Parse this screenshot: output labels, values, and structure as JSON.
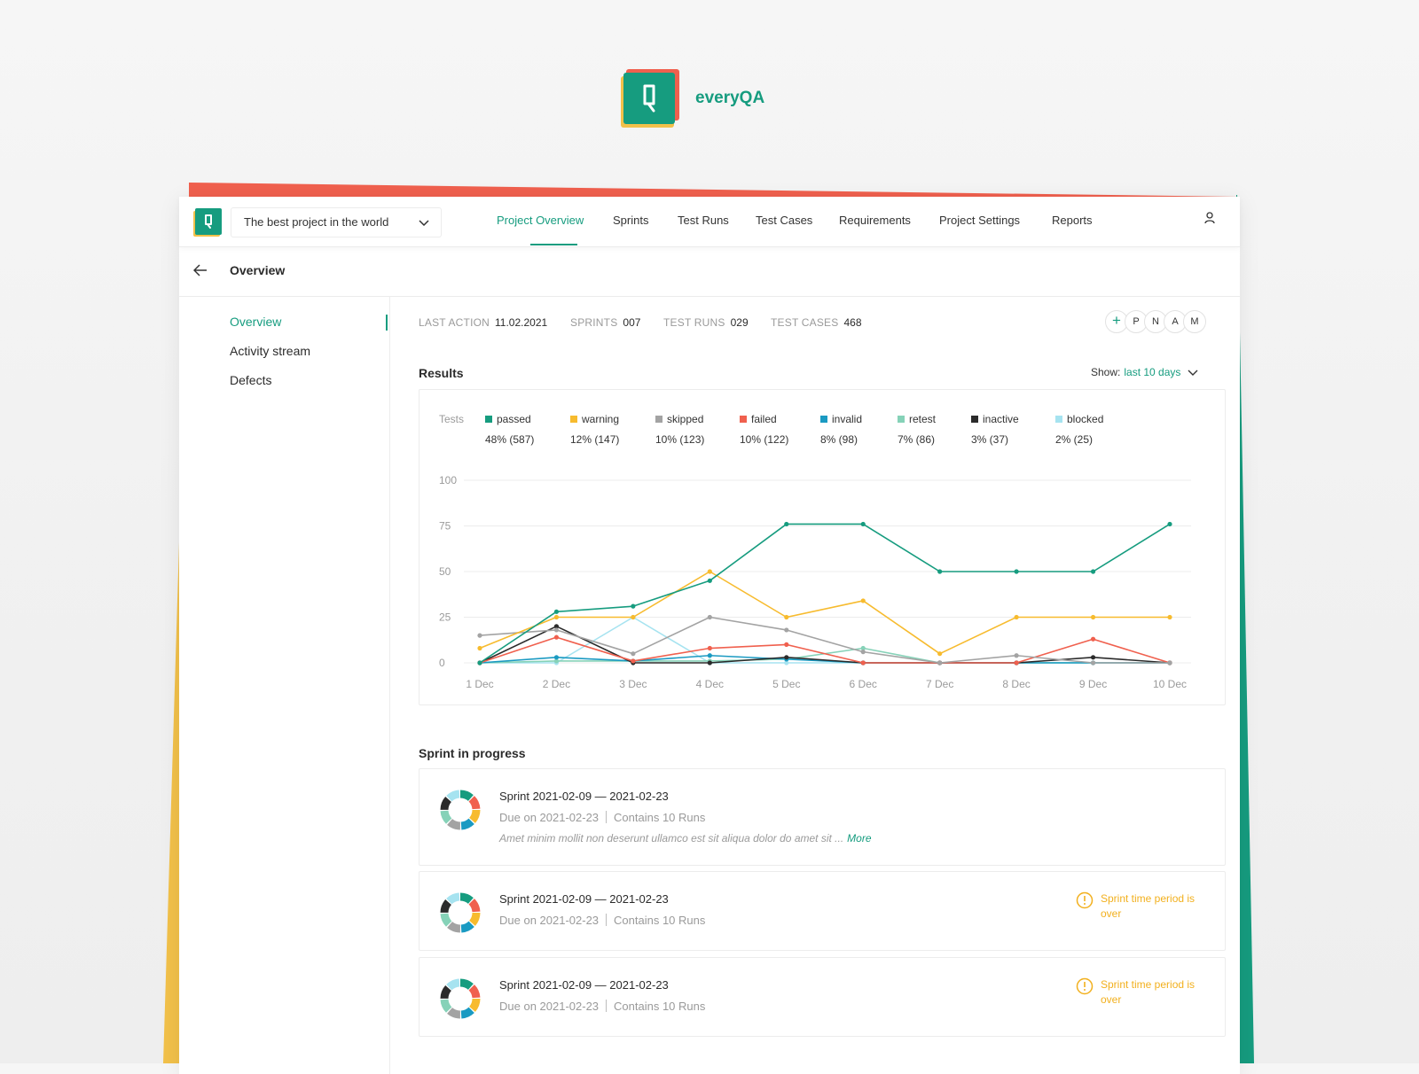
{
  "brand": {
    "name": "everyQA",
    "logo_icon": "qa-logo-icon"
  },
  "colors": {
    "accent": "#169c7f",
    "red": "#f0604e",
    "yellow": "#f2c14a",
    "passed": "#169c7f",
    "warning": "#f7bb2e",
    "skipped": "#a3a3a3",
    "failed": "#f0604e",
    "invalid": "#1a9ac2",
    "retest": "#86d2b8",
    "inactive": "#2b2b2b",
    "blocked": "#a6e3f0"
  },
  "topbar": {
    "project": "The best project in the world",
    "nav": [
      {
        "label": "Project Overview",
        "active": true
      },
      {
        "label": "Sprints"
      },
      {
        "label": "Test Runs"
      },
      {
        "label": "Test Cases"
      },
      {
        "label": "Requirements"
      },
      {
        "label": "Project Settings"
      },
      {
        "label": "Reports"
      }
    ],
    "user_icon": "user-icon"
  },
  "page": {
    "title": "Overview",
    "back_icon": "arrow-left-icon"
  },
  "sidebar": {
    "items": [
      {
        "label": "Overview",
        "active": true
      },
      {
        "label": "Activity stream"
      },
      {
        "label": "Defects"
      }
    ]
  },
  "stats": [
    {
      "key": "LAST ACTION",
      "value": "11.02.2021"
    },
    {
      "key": "SPRINTS",
      "value": "007"
    },
    {
      "key": "TEST RUNS",
      "value": "029"
    },
    {
      "key": "TEST CASES",
      "value": "468"
    }
  ],
  "members": {
    "add": "+",
    "initials": [
      "P",
      "N",
      "A",
      "M"
    ]
  },
  "results": {
    "title": "Results",
    "show_label": "Show:",
    "show_value": "last 10 days"
  },
  "legend": {
    "prefix": "Tests",
    "items": [
      {
        "name": "passed",
        "value": "48% (587)"
      },
      {
        "name": "warning",
        "value": "12% (147)"
      },
      {
        "name": "skipped",
        "value": "10% (123)"
      },
      {
        "name": "failed",
        "value": "10% (122)"
      },
      {
        "name": "invalid",
        "value": "8% (98)"
      },
      {
        "name": "retest",
        "value": "7% (86)"
      },
      {
        "name": "inactive",
        "value": "3% (37)"
      },
      {
        "name": "blocked",
        "value": "2% (25)"
      }
    ]
  },
  "chart_data": {
    "type": "line",
    "x": [
      "1 Dec",
      "2 Dec",
      "3 Dec",
      "4 Dec",
      "5 Dec",
      "6 Dec",
      "7 Dec",
      "8 Dec",
      "9 Dec",
      "10 Dec"
    ],
    "ylim": [
      0,
      100
    ],
    "yticks": [
      0,
      25,
      50,
      75,
      100
    ],
    "grid": true,
    "series": [
      {
        "name": "passed",
        "values": [
          0,
          28,
          31,
          45,
          76,
          76,
          50,
          50,
          50,
          76
        ]
      },
      {
        "name": "warning",
        "values": [
          8,
          25,
          25,
          50,
          25,
          34,
          5,
          25,
          25,
          25
        ]
      },
      {
        "name": "skipped",
        "values": [
          15,
          18,
          5,
          25,
          18,
          6,
          0,
          4,
          0,
          0
        ]
      },
      {
        "name": "failed",
        "values": [
          0,
          14,
          1,
          8,
          10,
          0,
          0,
          0,
          13,
          0
        ]
      },
      {
        "name": "invalid",
        "values": [
          0,
          3,
          1,
          4,
          2,
          0,
          0,
          0,
          0,
          0
        ]
      },
      {
        "name": "retest",
        "values": [
          0,
          1,
          1,
          1,
          2,
          8,
          0,
          0,
          0,
          0
        ]
      },
      {
        "name": "inactive",
        "values": [
          0,
          20,
          0,
          0,
          3,
          0,
          0,
          0,
          3,
          0
        ]
      },
      {
        "name": "blocked",
        "values": [
          0,
          0,
          25,
          0,
          0,
          0,
          0,
          0,
          0,
          0
        ]
      }
    ]
  },
  "sprints": {
    "title": "Sprint in progress",
    "items": [
      {
        "name": "Sprint 2021-02-09 — 2021-02-23",
        "due": "Due on 2021-02-23",
        "runs": "Contains 10 Runs",
        "desc": "Amet minim mollit non deserunt ullamco est sit aliqua dolor do amet sit ...",
        "more": "More",
        "warning": ""
      },
      {
        "name": "Sprint 2021-02-09 — 2021-02-23",
        "due": "Due on 2021-02-23",
        "runs": "Contains 10 Runs",
        "desc": "",
        "more": "",
        "warning": "Sprint time period is over"
      },
      {
        "name": "Sprint 2021-02-09 — 2021-02-23",
        "due": "Due on 2021-02-23",
        "runs": "Contains 10 Runs",
        "desc": "",
        "more": "",
        "warning": "Sprint time period is over"
      }
    ]
  }
}
